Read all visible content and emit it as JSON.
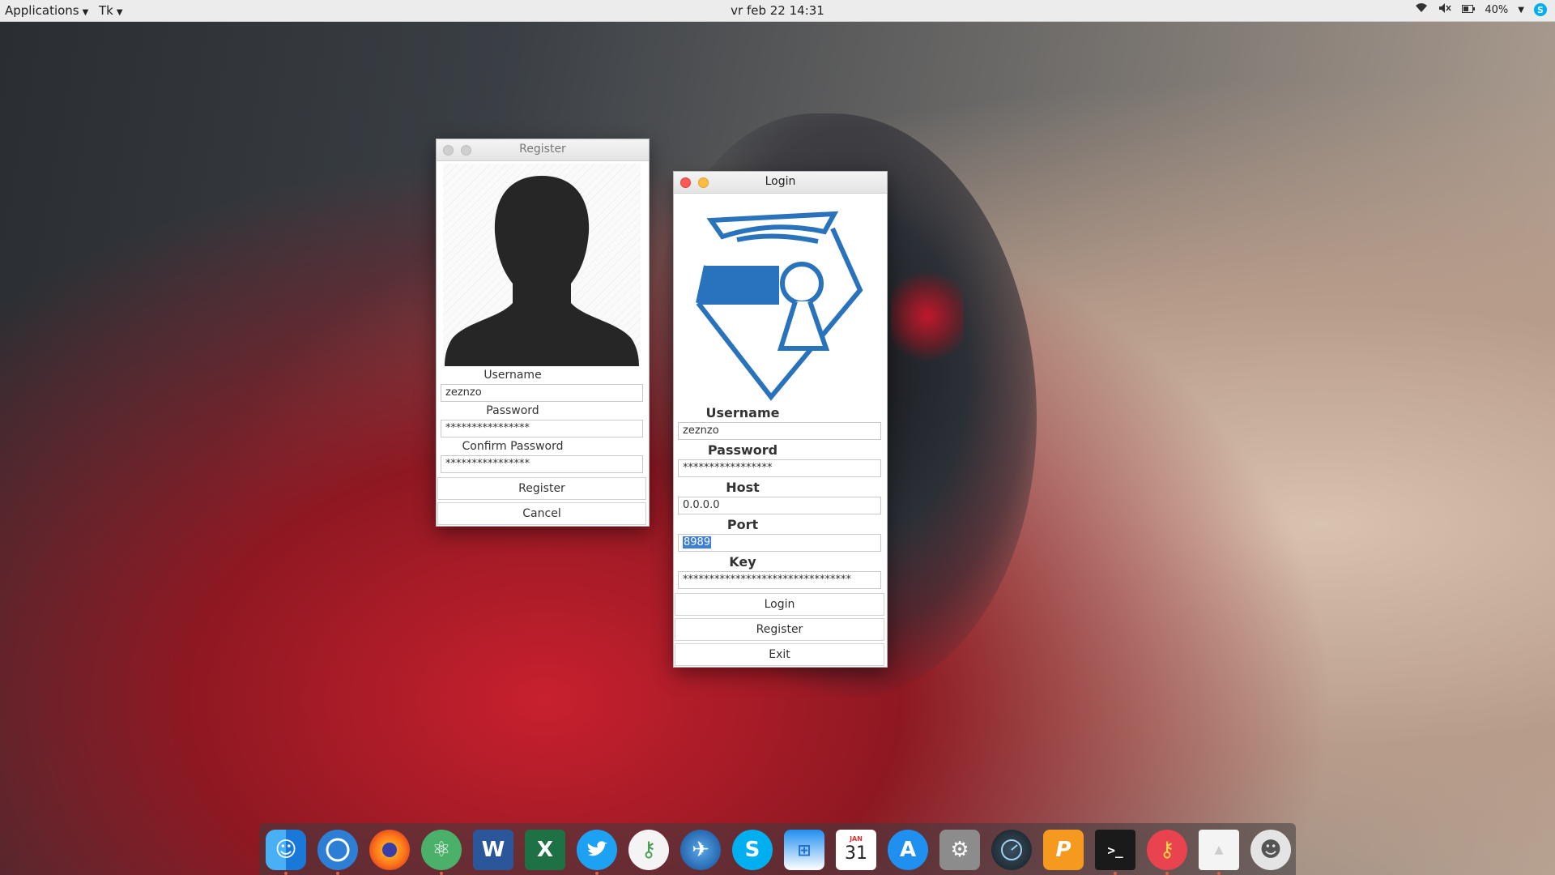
{
  "top_panel": {
    "applications_menu": "Applications",
    "app_menu": "Tk",
    "clock": "vr feb 22  14:31",
    "battery": "40%"
  },
  "register_window": {
    "title": "Register",
    "username_label": "Username",
    "username_value": "zeznzo",
    "password_label": "Password",
    "password_value": "****************",
    "confirm_label": "Confirm Password",
    "confirm_value": "****************",
    "register_button": "Register",
    "cancel_button": "Cancel"
  },
  "login_window": {
    "title": "Login",
    "username_label": "Username",
    "username_value": "zeznzo",
    "password_label": "Password",
    "password_value": "*****************",
    "host_label": "Host",
    "host_value": "0.0.0.0",
    "port_label": "Port",
    "port_value": "8989",
    "key_label": "Key",
    "key_value": "********************************",
    "login_button": "Login",
    "register_button": "Register",
    "exit_button": "Exit"
  },
  "dock": {
    "calendar_month": "JAN",
    "calendar_day": "31",
    "items": [
      "finder-icon",
      "chromium-icon",
      "firefox-icon",
      "atom-icon",
      "word-icon",
      "excel-icon",
      "twitter-icon",
      "keys-icon",
      "browser-icon",
      "skype-icon",
      "windows-apple-icon",
      "calendar-icon",
      "app-store-icon",
      "settings-icon",
      "dashboard-icon",
      "wps-icon",
      "terminal-icon",
      "key-app-icon",
      "blank-app-icon",
      "turtle-icon"
    ]
  },
  "colors": {
    "accent_blue": "#2873bb",
    "selection": "#3d7ed8",
    "close_red": "#fc5a56",
    "min_yellow": "#fdbc40"
  }
}
